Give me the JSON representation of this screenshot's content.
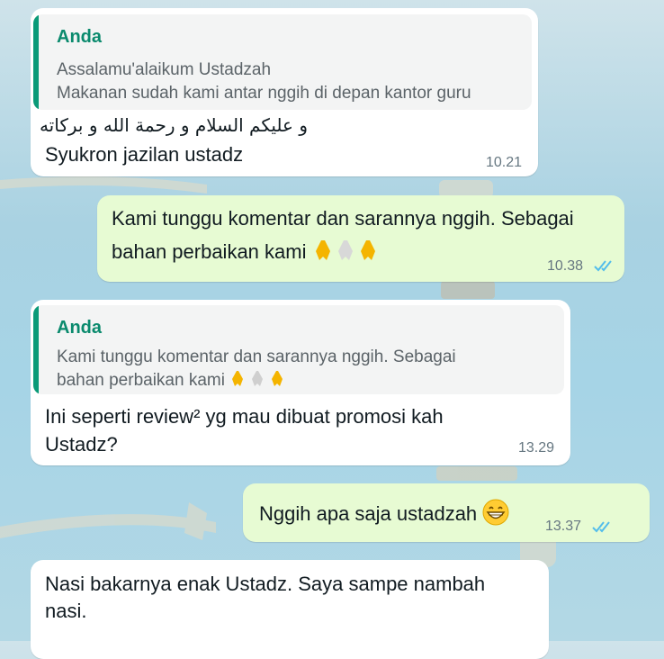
{
  "messages": [
    {
      "direction": "incoming",
      "quote": {
        "author": "Anda",
        "lines": [
          "Assalamu'alaikum Ustadzah",
          "Makanan sudah kami antar nggih di depan kantor guru"
        ]
      },
      "arabic": "و عليكم السلام و رحمة الله و بركاته",
      "text": "Syukron jazilan ustadz",
      "time": "10.21"
    },
    {
      "direction": "outgoing",
      "lines": [
        "Kami tunggu komentar dan sarannya nggih. Sebagai",
        "bahan perbaikan kami"
      ],
      "emoji": [
        "folded-hands",
        "folded-hands",
        "folded-hands"
      ],
      "time": "10.38",
      "status": "read"
    },
    {
      "direction": "incoming",
      "quote": {
        "author": "Anda",
        "lines": [
          "Kami tunggu komentar dan sarannya nggih. Sebagai",
          "bahan perbaikan kami"
        ],
        "emoji": [
          "folded-hands",
          "folded-hands",
          "folded-hands"
        ]
      },
      "lines": [
        "Ini seperti review² yg mau dibuat promosi kah",
        "Ustadz?"
      ],
      "time": "13.29"
    },
    {
      "direction": "outgoing",
      "text": "Nggih apa saja ustadzah",
      "emoji": [
        "grinning-face"
      ],
      "time": "13.37",
      "status": "read"
    },
    {
      "direction": "incoming",
      "lines": [
        "Nasi bakarnya enak Ustadz. Saya sampe nambah",
        "nasi."
      ]
    }
  ],
  "colors": {
    "incoming_bubble": "#ffffff",
    "outgoing_bubble": "#e7fbd3",
    "quote_bar": "#0a9a78",
    "read_ticks": "#53bdeb",
    "wallpaper": "#a6d4e6"
  }
}
